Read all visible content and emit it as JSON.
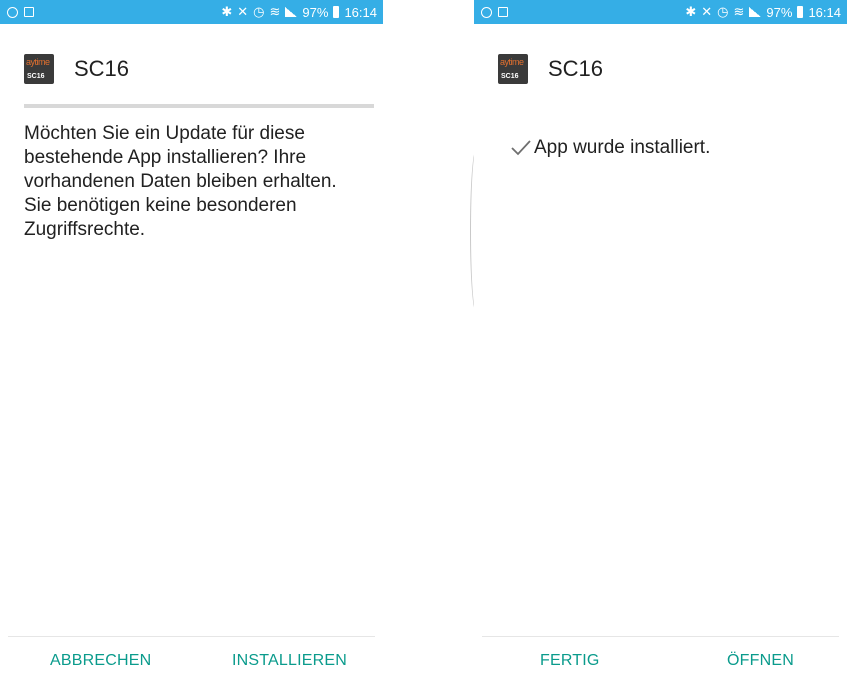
{
  "colors": {
    "status_bar": "#35aee6",
    "accent": "#0a9b8c",
    "text": "#212121",
    "divider": "#d8d8d8"
  },
  "left_screen": {
    "status_bar": {
      "left_icons": [
        "whatsapp-icon",
        "gallery-icon"
      ],
      "right_icons": [
        "bluetooth-icon",
        "mute-icon",
        "alarm-icon",
        "wifi-icon",
        "signal-icon"
      ],
      "battery": "97%",
      "time": "16:14"
    },
    "app": {
      "icon_top_text": "aytime",
      "icon_bottom_text": "SC16",
      "name": "SC16"
    },
    "message": "Möchten Sie ein Update für diese bestehende App installieren? Ihre vorhandenen Daten bleiben erhalten. Sie benötigen keine besonderen Zugriffsrechte.",
    "buttons": {
      "cancel": "ABBRECHEN",
      "install": "INSTALLIEREN"
    }
  },
  "right_screen": {
    "status_bar": {
      "left_icons": [
        "whatsapp-icon",
        "gallery-icon"
      ],
      "right_icons": [
        "bluetooth-icon",
        "mute-icon",
        "alarm-icon",
        "wifi-icon",
        "signal-icon"
      ],
      "battery": "97%",
      "time": "16:14"
    },
    "app": {
      "icon_top_text": "aytime",
      "icon_bottom_text": "SC16",
      "name": "SC16"
    },
    "status_message": "App wurde installiert.",
    "buttons": {
      "done": "FERTIG",
      "open": "ÖFFNEN"
    }
  }
}
